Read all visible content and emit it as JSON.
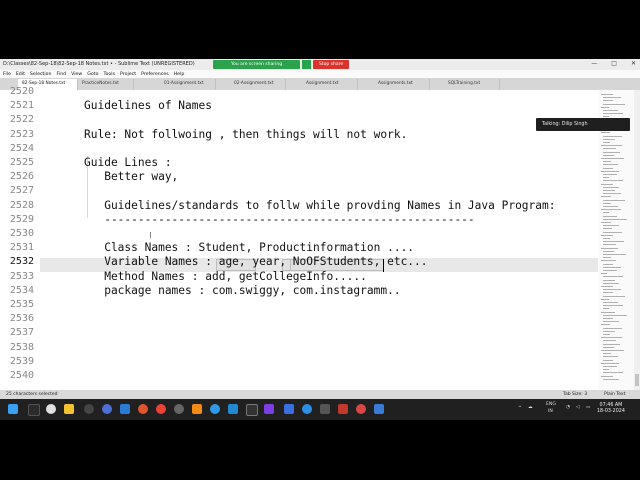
{
  "window": {
    "title": "D:\\Classes\\82-Sep-18\\82-Sep-18 Notes.txt • - Sublime Text (UNREGISTERED)",
    "controls": [
      "—",
      "□",
      "✕"
    ]
  },
  "screen_share": {
    "label": "You are screen sharing",
    "stop_label": "Stop share"
  },
  "menu": [
    "File",
    "Edit",
    "Selection",
    "Find",
    "View",
    "Goto",
    "Tools",
    "Project",
    "Preferences",
    "Help"
  ],
  "tabs": [
    {
      "label": "82-Sep-18 Notes.txt"
    },
    {
      "label": "PracticeNotes.txt"
    },
    {
      "label": "01-Assignment.txt"
    },
    {
      "label": "02-Assignment.txt"
    },
    {
      "label": "Assignment.txt"
    },
    {
      "label": "Assignments.txt"
    },
    {
      "label": "SQLTraining.txt"
    }
  ],
  "editor": {
    "lines": [
      {
        "num": "2520",
        "text": ""
      },
      {
        "num": "2521",
        "text": "Guidelines of Names"
      },
      {
        "num": "2522",
        "text": ""
      },
      {
        "num": "2523",
        "text": "Rule: Not follwoing , then things will not work."
      },
      {
        "num": "2524",
        "text": ""
      },
      {
        "num": "2525",
        "text": "Guide Lines :"
      },
      {
        "num": "2526",
        "text": "   Better way,"
      },
      {
        "num": "2527",
        "text": ""
      },
      {
        "num": "2528",
        "text": "   Guidelines/standards to follw while provding Names in Java Program:"
      },
      {
        "num": "2529",
        "text": "   -------------------------------------------------------"
      },
      {
        "num": "2530",
        "text": ""
      },
      {
        "num": "2531",
        "text": "   Class Names : Student, Productinformation ...."
      },
      {
        "num": "2532",
        "text": "   Variable Names : age, year, NoOFStudents, etc..."
      },
      {
        "num": "2533",
        "text": "   Method Names : add, getCollegeInfo....."
      },
      {
        "num": "2534",
        "text": "   package names : com.swiggy, com.instagramm.."
      },
      {
        "num": "2535",
        "text": ""
      },
      {
        "num": "2536",
        "text": ""
      },
      {
        "num": "2537",
        "text": ""
      },
      {
        "num": "2538",
        "text": ""
      },
      {
        "num": "2539",
        "text": ""
      },
      {
        "num": "2540",
        "text": ""
      }
    ],
    "current_line": "2532"
  },
  "meeting": {
    "talking": "Talking: Dilip Singh"
  },
  "status": {
    "selection": "25 characters selected",
    "tab_size": "Tab Size: 3",
    "syntax": "Plain Text"
  },
  "taskbar": {
    "language": "ENG",
    "region": "IN",
    "time": "07:46 AM",
    "date": "18-03-2024"
  },
  "colors": {
    "share_green": "#2ba24c",
    "stop_red": "#d9342b",
    "taskbar": "#202020"
  }
}
